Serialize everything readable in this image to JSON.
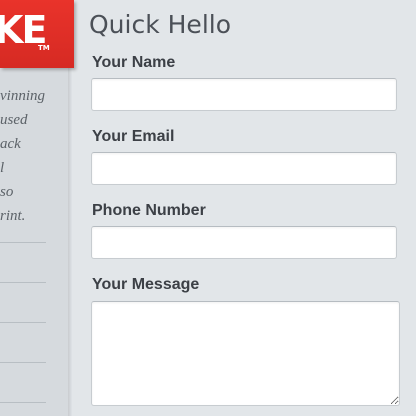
{
  "logo": {
    "text": "KE",
    "tm": "TM"
  },
  "sidebar": {
    "lines": [
      "vinning",
      "used",
      "ack",
      "l",
      "so",
      "rint."
    ]
  },
  "form": {
    "heading": "Quick Hello",
    "fields": {
      "name": {
        "label": "Your Name",
        "value": ""
      },
      "email": {
        "label": "Your Email",
        "value": ""
      },
      "phone": {
        "label": "Phone Number",
        "value": ""
      },
      "message": {
        "label": "Your Message",
        "value": ""
      }
    }
  },
  "colors": {
    "brand_red": "#e2302a",
    "background": "#e2e6e9",
    "sidebar": "#d6dade",
    "label": "#3c4046"
  }
}
